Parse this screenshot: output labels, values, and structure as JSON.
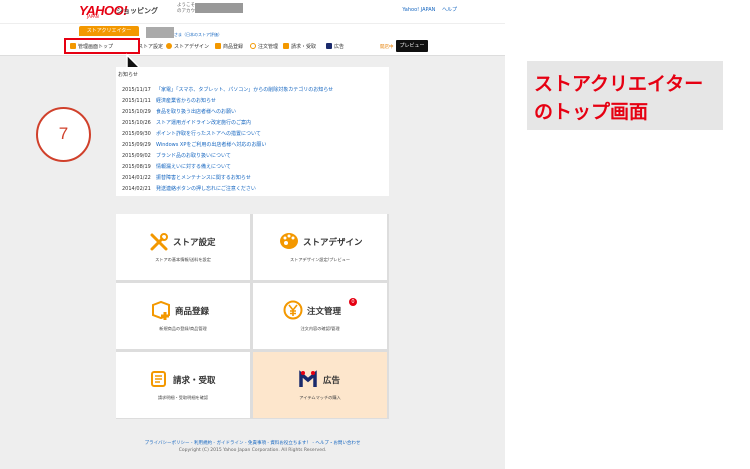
{
  "header": {
    "logo": "YAHOO!",
    "logo_sub": "JAPAN",
    "shop_label": "ショッピング",
    "welcome_line1": "ようこそ",
    "welcome_line2": "のアカウ",
    "links": [
      "Yahoo! JAPAN",
      "ヘルプ"
    ]
  },
  "tabs": {
    "creator_tab": "ストアクリエイター",
    "store_sub": "さま（日本のストア評価）"
  },
  "nav": {
    "items": [
      "管理画面トップ",
      "ストア設定",
      "ストアデザイン",
      "商品登録",
      "注文管理",
      "請求・受取",
      "広告"
    ],
    "status": "開店中",
    "preview": "プレビュー"
  },
  "news": {
    "title": "お知らせ",
    "items": [
      {
        "date": "2015/11/17",
        "text": "「家電」「スマホ、タブレット、パソコン」からの削除対象カテゴリのお知らせ"
      },
      {
        "date": "2015/11/11",
        "text": "経済産業省からのお知らせ"
      },
      {
        "date": "2015/10/29",
        "text": "食品を取り扱う出店者様へのお願い"
      },
      {
        "date": "2015/10/26",
        "text": "ストア運用ガイドライン改定施行のご案内"
      },
      {
        "date": "2015/09/30",
        "text": "ポイント詐取を行ったストアへの措置について"
      },
      {
        "date": "2015/09/29",
        "text": "Windows XPをご利用の出店者様へ対応のお願い"
      },
      {
        "date": "2015/09/02",
        "text": "ブランド品のお取り扱いについて"
      },
      {
        "date": "2015/08/19",
        "text": "情報漏えいに対する備えについて"
      },
      {
        "date": "2014/01/22",
        "text": "振替障害とメンテナンスに関するお知らせ"
      },
      {
        "date": "2014/02/21",
        "text": "発送連絡ボタンの押し忘れにご注意ください"
      }
    ]
  },
  "tiles": [
    {
      "title": "ストア設定",
      "desc": "ストアの基本情報/送料を設定",
      "icon": "tools-icon"
    },
    {
      "title": "ストアデザイン",
      "desc": "ストアデザイン設定/プレビュー",
      "icon": "palette-icon"
    },
    {
      "title": "商品登録",
      "desc": "新規商品の登録/商品管理",
      "icon": "product-box-icon"
    },
    {
      "title": "注文管理",
      "desc": "注文内容の確認/管理",
      "icon": "yen-icon",
      "badge": "0"
    },
    {
      "title": "請求・受取",
      "desc": "請求明細・受取明細を確認",
      "icon": "scroll-icon"
    },
    {
      "title": "広告",
      "desc": "アイテムマッチの購入",
      "icon": "item-match-icon"
    }
  ],
  "footer": {
    "links": "プライバシーポリシー - 利用規約 - ガイドライン - 免責事項 - 資料お役立ちます！ - ヘルプ・お問い合わせ",
    "copyright": "Copyright (C) 2015 Yahoo Japan Corporation. All Rights Reserved."
  },
  "annotation": {
    "step": "7",
    "caption_line1": "ストアクリエイター",
    "caption_line2": "のトップ画面"
  },
  "colors": {
    "accent": "#f39800",
    "yahoo_red": "#e60012",
    "link": "#1566c0",
    "highlight_box": "#e60012"
  }
}
